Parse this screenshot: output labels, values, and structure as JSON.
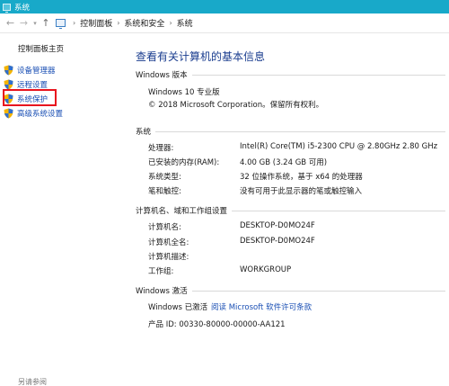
{
  "window": {
    "title": "系统"
  },
  "addressbar": {
    "crumbs": [
      "控制面板",
      "系统和安全",
      "系统"
    ]
  },
  "left": {
    "home": "控制面板主页",
    "links": [
      "设备管理器",
      "远程设置",
      "系统保护",
      "高级系统设置"
    ],
    "see_also": "另请参阅"
  },
  "main": {
    "title": "查看有关计算机的基本信息",
    "edition": {
      "heading": "Windows 版本",
      "name": "Windows 10 专业版",
      "copyright": "© 2018 Microsoft Corporation。保留所有权利。"
    },
    "system": {
      "heading": "系统",
      "rows": [
        {
          "label": "处理器:",
          "value": "Intel(R) Core(TM) i5-2300 CPU @ 2.80GHz   2.80 GHz"
        },
        {
          "label": "已安装的内存(RAM):",
          "value": "4.00 GB (3.24 GB 可用)"
        },
        {
          "label": "系统类型:",
          "value": "32 位操作系统，基于 x64 的处理器"
        },
        {
          "label": "笔和触控:",
          "value": "没有可用于此显示器的笔或触控输入"
        }
      ]
    },
    "computer": {
      "heading": "计算机名、域和工作组设置",
      "rows": [
        {
          "label": "计算机名:",
          "value": "DESKTOP-D0MO24F"
        },
        {
          "label": "计算机全名:",
          "value": "DESKTOP-D0MO24F"
        },
        {
          "label": "计算机描述:",
          "value": ""
        },
        {
          "label": "工作组:",
          "value": "WORKGROUP"
        }
      ]
    },
    "activation": {
      "heading": "Windows 激活",
      "status": "Windows 已激活",
      "license_link": "阅读 Microsoft 软件许可条款",
      "product_id": "产品 ID: 00330-80000-00000-AA121"
    }
  },
  "colors": {
    "titlebar": "#18a9c9",
    "link": "#1a4fb4",
    "page_title": "#1a3d8f",
    "highlight": "#e8141e"
  }
}
